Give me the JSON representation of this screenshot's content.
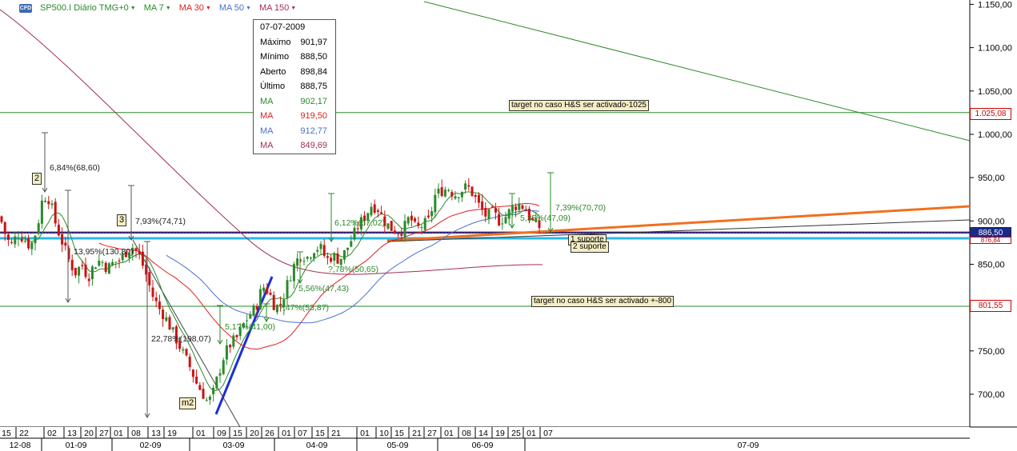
{
  "header": {
    "logo": "CFD",
    "symbol": "SP500.I Diário TMG+0",
    "indicators": [
      {
        "label": "MA 7",
        "color": "#2a8a2a"
      },
      {
        "label": "MA 30",
        "color": "#e02020"
      },
      {
        "label": "MA 50",
        "color": "#4a6fd0"
      },
      {
        "label": "MA 150",
        "color": "#a03050"
      }
    ]
  },
  "tooltip": {
    "date": "07-07-2009",
    "rows": [
      {
        "label": "Máximo",
        "value": "901,97",
        "color": "#000000"
      },
      {
        "label": "Mínimo",
        "value": "888,50",
        "color": "#000000"
      },
      {
        "label": "Aberto",
        "value": "898,84",
        "color": "#000000"
      },
      {
        "label": "Último",
        "value": "888,75",
        "color": "#000000"
      },
      {
        "label": "MA",
        "value": "902,17",
        "color": "#2a8a2a"
      },
      {
        "label": "MA",
        "value": "919,50",
        "color": "#e02020"
      },
      {
        "label": "MA",
        "value": "912,77",
        "color": "#4a6fd0"
      },
      {
        "label": "MA",
        "value": "849,69",
        "color": "#a03050"
      }
    ]
  },
  "annotations": {
    "target_1025": "target no caso H&S ser activado-1025",
    "target_800": "target no caso H&S ser activado +-800",
    "suporte_1": "1 suporte",
    "suporte_2": "2 suporte",
    "tag_2": "2",
    "tag_3": "3",
    "tag_m2": "m2",
    "pct": [
      {
        "text": "6,84%(68,60)"
      },
      {
        "text": "7,93%(74,71)"
      },
      {
        "text": "13,95%(130,89)"
      },
      {
        "text": "22,78%(198,07)"
      },
      {
        "text": "5,1?%(41,00)"
      },
      {
        "text": "5,56%(47,43)"
      },
      {
        "text": "?,47%(53,87)"
      },
      {
        "text": "?,78%(50,65)"
      },
      {
        "text": "6,12%(57,02)"
      },
      {
        "text": "5,35%(47,09)"
      },
      {
        "text": "7,39%(70,70)"
      }
    ]
  },
  "price_boxes": {
    "p1025": "1.025,08",
    "p886": "886,50",
    "p876": "876,84",
    "p801": "801,55"
  },
  "colors": {
    "up": "#2a8a2a",
    "down": "#cc1111",
    "ma7": "#2a8a2a",
    "ma30": "#e02020",
    "ma50": "#4a6fd0",
    "ma150": "#a03050",
    "support_line": "#29b8e8",
    "trendline_orange": "#f07020",
    "trendline_blue": "#1a2fd8",
    "hline": "#2a8a2a"
  },
  "chart_data": {
    "type": "candlestick",
    "ylim": [
      660,
      1160
    ],
    "yticks": [
      "700,00",
      "750,00",
      "800,00",
      "850,00",
      "900,00",
      "950,00",
      "1.000,00",
      "1.050,00",
      "1.100,00",
      "1.150,00"
    ],
    "ytick_values": [
      700,
      750,
      800,
      850,
      900,
      950,
      1000,
      1050,
      1100,
      1150
    ],
    "x_day_labels": [
      "15",
      "22",
      "02",
      "13",
      "20",
      "27",
      "01",
      "08",
      "13",
      "19",
      "01",
      "09",
      "15",
      "20",
      "26",
      "01",
      "07",
      "15",
      "21",
      "01",
      "10",
      "15",
      "21",
      "27",
      "01",
      "08",
      "14",
      "19",
      "25",
      "01",
      "07"
    ],
    "x_month_labels": [
      "12-08",
      "01-09",
      "02-09",
      "03-09",
      "04-09",
      "05-09",
      "06-09",
      "07-09"
    ],
    "horizontal_lines": [
      1025.08,
      801.55,
      886.5,
      876.84
    ],
    "series": [
      {
        "name": "MA 7"
      },
      {
        "name": "MA 30"
      },
      {
        "name": "MA 50"
      },
      {
        "name": "MA 150"
      }
    ],
    "last_close": 888.75
  }
}
